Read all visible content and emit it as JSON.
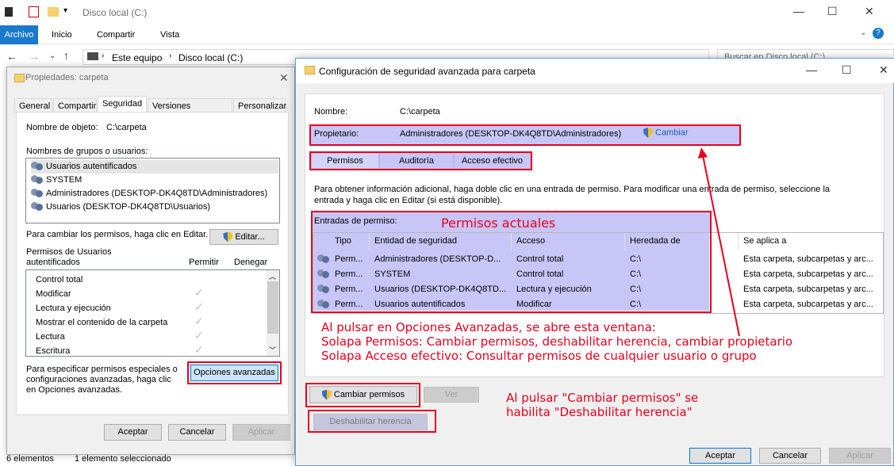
{
  "explorer": {
    "title": "Disco local (C:)",
    "ribbon": {
      "file": "Archivo",
      "tabs": [
        "Inicio",
        "Compartir",
        "Vista"
      ]
    },
    "breadcrumb": [
      "Este equipo",
      "Disco local (C:)"
    ],
    "search_placeholder": "Buscar en Disco local (C:)",
    "status": {
      "count": "6 elementos",
      "selected": "1 elemento seleccionado"
    }
  },
  "properties": {
    "title": "Propiedades: carpeta",
    "tabs": [
      "General",
      "Compartir",
      "Seguridad",
      "Versiones anteriores",
      "Personalizar"
    ],
    "active_tab": "Seguridad",
    "object_label": "Nombre de objeto:",
    "object_value": "C:\\carpeta",
    "groups_label": "Nombres de grupos o usuarios:",
    "groups": [
      "Usuarios autentificados",
      "SYSTEM",
      "Administradores (DESKTOP-DK4Q8TD\\Administradores)",
      "Usuarios (DESKTOP-DK4Q8TD\\Usuarios)"
    ],
    "change_hint": "Para cambiar los permisos, haga clic en Editar.",
    "edit_button": "Editar...",
    "perms_for_line1": "Permisos de Usuarios",
    "perms_for_line2": "autentificados",
    "allow_header": "Permitir",
    "deny_header": "Denegar",
    "permissions": [
      {
        "name": "Control total",
        "allow": false
      },
      {
        "name": "Modificar",
        "allow": true
      },
      {
        "name": "Lectura y ejecución",
        "allow": true
      },
      {
        "name": "Mostrar el contenido de la carpeta",
        "allow": true
      },
      {
        "name": "Lectura",
        "allow": true
      },
      {
        "name": "Escritura",
        "allow": true
      }
    ],
    "special_line1": "Para especificar permisos especiales o",
    "special_line2": "configuraciones avanzadas, haga clic",
    "special_line3": "en Opciones avanzadas.",
    "advanced_button": "Opciones avanzadas",
    "accept": "Aceptar",
    "cancel": "Cancelar",
    "apply": "Aplicar"
  },
  "advanced": {
    "title": "Configuración de seguridad avanzada para carpeta",
    "name_label": "Nombre:",
    "name_value": "C:\\carpeta",
    "owner_label": "Propietario:",
    "owner_value": "Administradores (DESKTOP-DK4Q8TD\\Administradores)",
    "change_link": "Cambiar",
    "tabs": [
      "Permisos",
      "Auditoría",
      "Acceso efectivo"
    ],
    "info_line1": "Para obtener información adicional, haga doble clic en una entrada de permiso. Para modificar una entrada de permiso, seleccione la",
    "info_line2": "entrada y haga clic en Editar (si está disponible).",
    "entries_label": "Entradas de permiso:",
    "columns": [
      "Tipo",
      "Entidad de seguridad",
      "Acceso",
      "Heredada de",
      "Se aplica a"
    ],
    "rows": [
      {
        "type": "Perm...",
        "principal": "Administradores (DESKTOP-D...",
        "access": "Control total",
        "inherited": "C:\\",
        "applies": "Esta carpeta, subcarpetas y arc..."
      },
      {
        "type": "Perm...",
        "principal": "SYSTEM",
        "access": "Control total",
        "inherited": "C:\\",
        "applies": "Esta carpeta, subcarpetas y arc..."
      },
      {
        "type": "Perm...",
        "principal": "Usuarios (DESKTOP-DK4Q8TD...",
        "access": "Lectura y ejecución",
        "inherited": "C:\\",
        "applies": "Esta carpeta, subcarpetas y arc..."
      },
      {
        "type": "Perm...",
        "principal": "Usuarios autentificados",
        "access": "Modificar",
        "inherited": "C:\\",
        "applies": "Esta carpeta, subcarpetas y arc..."
      }
    ],
    "change_perms_button": "Cambiar permisos",
    "view_button": "Ver",
    "disable_inherit_button": "Deshabilitar herencia",
    "accept": "Aceptar",
    "cancel": "Cancelar",
    "apply": "Aplicar"
  },
  "annotations": {
    "current_perms": "Permisos actuales",
    "line1": "Al pulsar en Opciones Avanzadas, se abre esta ventana:",
    "line2": "Solapa Permisos:   Cambiar permisos, deshabilitar herencia, cambiar propietario",
    "line3": "Solapa Acceso efectivo: Consultar permisos de cualquier usuario o grupo",
    "note1": "Al pulsar \"Cambiar permisos\" se",
    "note2": "habilita \"Deshabilitar herencia\""
  },
  "colors": {
    "highlight": "#c7c6f7",
    "annotation": "#e8001e",
    "accent": "#1979ca"
  }
}
